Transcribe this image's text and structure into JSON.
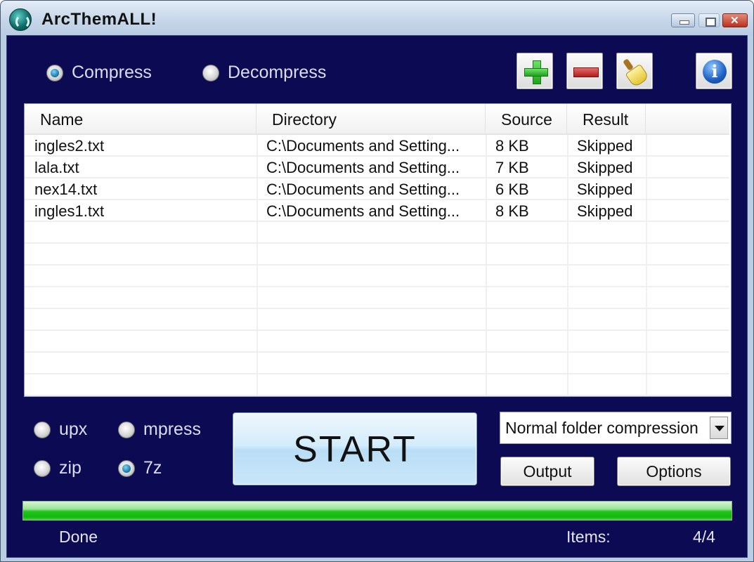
{
  "window": {
    "title": "ArcThemALL!",
    "controls": {
      "minimize": "minimize",
      "maximize": "maximize",
      "close": "close"
    }
  },
  "mode": {
    "options": [
      {
        "label": "Compress",
        "checked": true
      },
      {
        "label": "Decompress",
        "checked": false
      }
    ]
  },
  "toolbar": {
    "buttons": [
      {
        "name": "add",
        "icon": "plus-icon"
      },
      {
        "name": "remove",
        "icon": "minus-icon"
      },
      {
        "name": "clear",
        "icon": "broom-icon"
      },
      {
        "name": "about",
        "icon": "info-icon"
      }
    ]
  },
  "file_list": {
    "columns": [
      "Name",
      "Directory",
      "Source",
      "Result"
    ],
    "rows": [
      {
        "name": "ingles2.txt",
        "directory": "C:\\Documents and Setting...",
        "source": "8 KB",
        "result": "Skipped"
      },
      {
        "name": "lala.txt",
        "directory": "C:\\Documents and Setting...",
        "source": "7 KB",
        "result": "Skipped"
      },
      {
        "name": "nex14.txt",
        "directory": "C:\\Documents and Setting...",
        "source": "6 KB",
        "result": "Skipped"
      },
      {
        "name": "ingles1.txt",
        "directory": "C:\\Documents and Setting...",
        "source": "8 KB",
        "result": "Skipped"
      }
    ]
  },
  "format": {
    "options": [
      {
        "label": "upx",
        "checked": false
      },
      {
        "label": "mpress",
        "checked": false
      },
      {
        "label": "zip",
        "checked": false
      },
      {
        "label": "7z",
        "checked": true
      }
    ]
  },
  "start_label": "START",
  "compression_select": {
    "value": "Normal folder compression"
  },
  "output_label": "Output",
  "options_label": "Options",
  "progress": {
    "percent": 100,
    "color": "#1fc31a"
  },
  "status": {
    "text": "Done",
    "items_label": "Items:",
    "items_value": "4/4"
  }
}
